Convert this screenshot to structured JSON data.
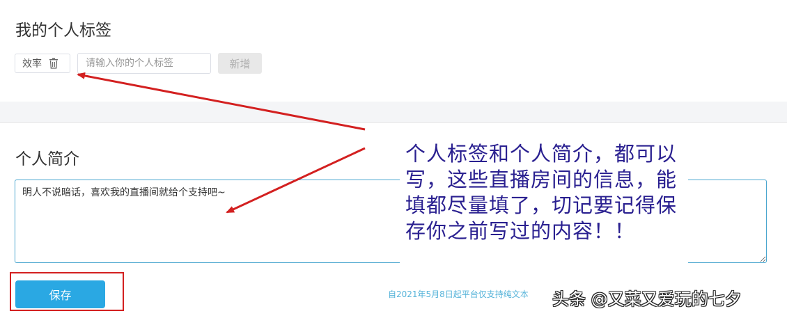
{
  "tags": {
    "title": "我的个人标签",
    "items": [
      {
        "label": "效率",
        "icon": "trash-icon"
      }
    ],
    "input_placeholder": "请输入你的个人标签",
    "add_label": "新增"
  },
  "bio": {
    "title": "个人简介",
    "text": "明人不说暗话，喜欢我的直播间就给个支持吧~",
    "save_label": "保存",
    "notice": "自2021年5月8日起平台仅支持纯文本"
  },
  "annotation": {
    "text": "个人标签和个人简介，都可以写，这些直播房间的信息，能填都尽量填了，切记要记得保存你之前写过的内容！！",
    "color": "#2a2090",
    "arrow_color": "#d32020"
  },
  "watermark": "头条 @又菜又爱玩的七夕",
  "colors": {
    "accent": "#2aa8e3",
    "notice": "#56b3d9",
    "highlight": "#d32020"
  }
}
